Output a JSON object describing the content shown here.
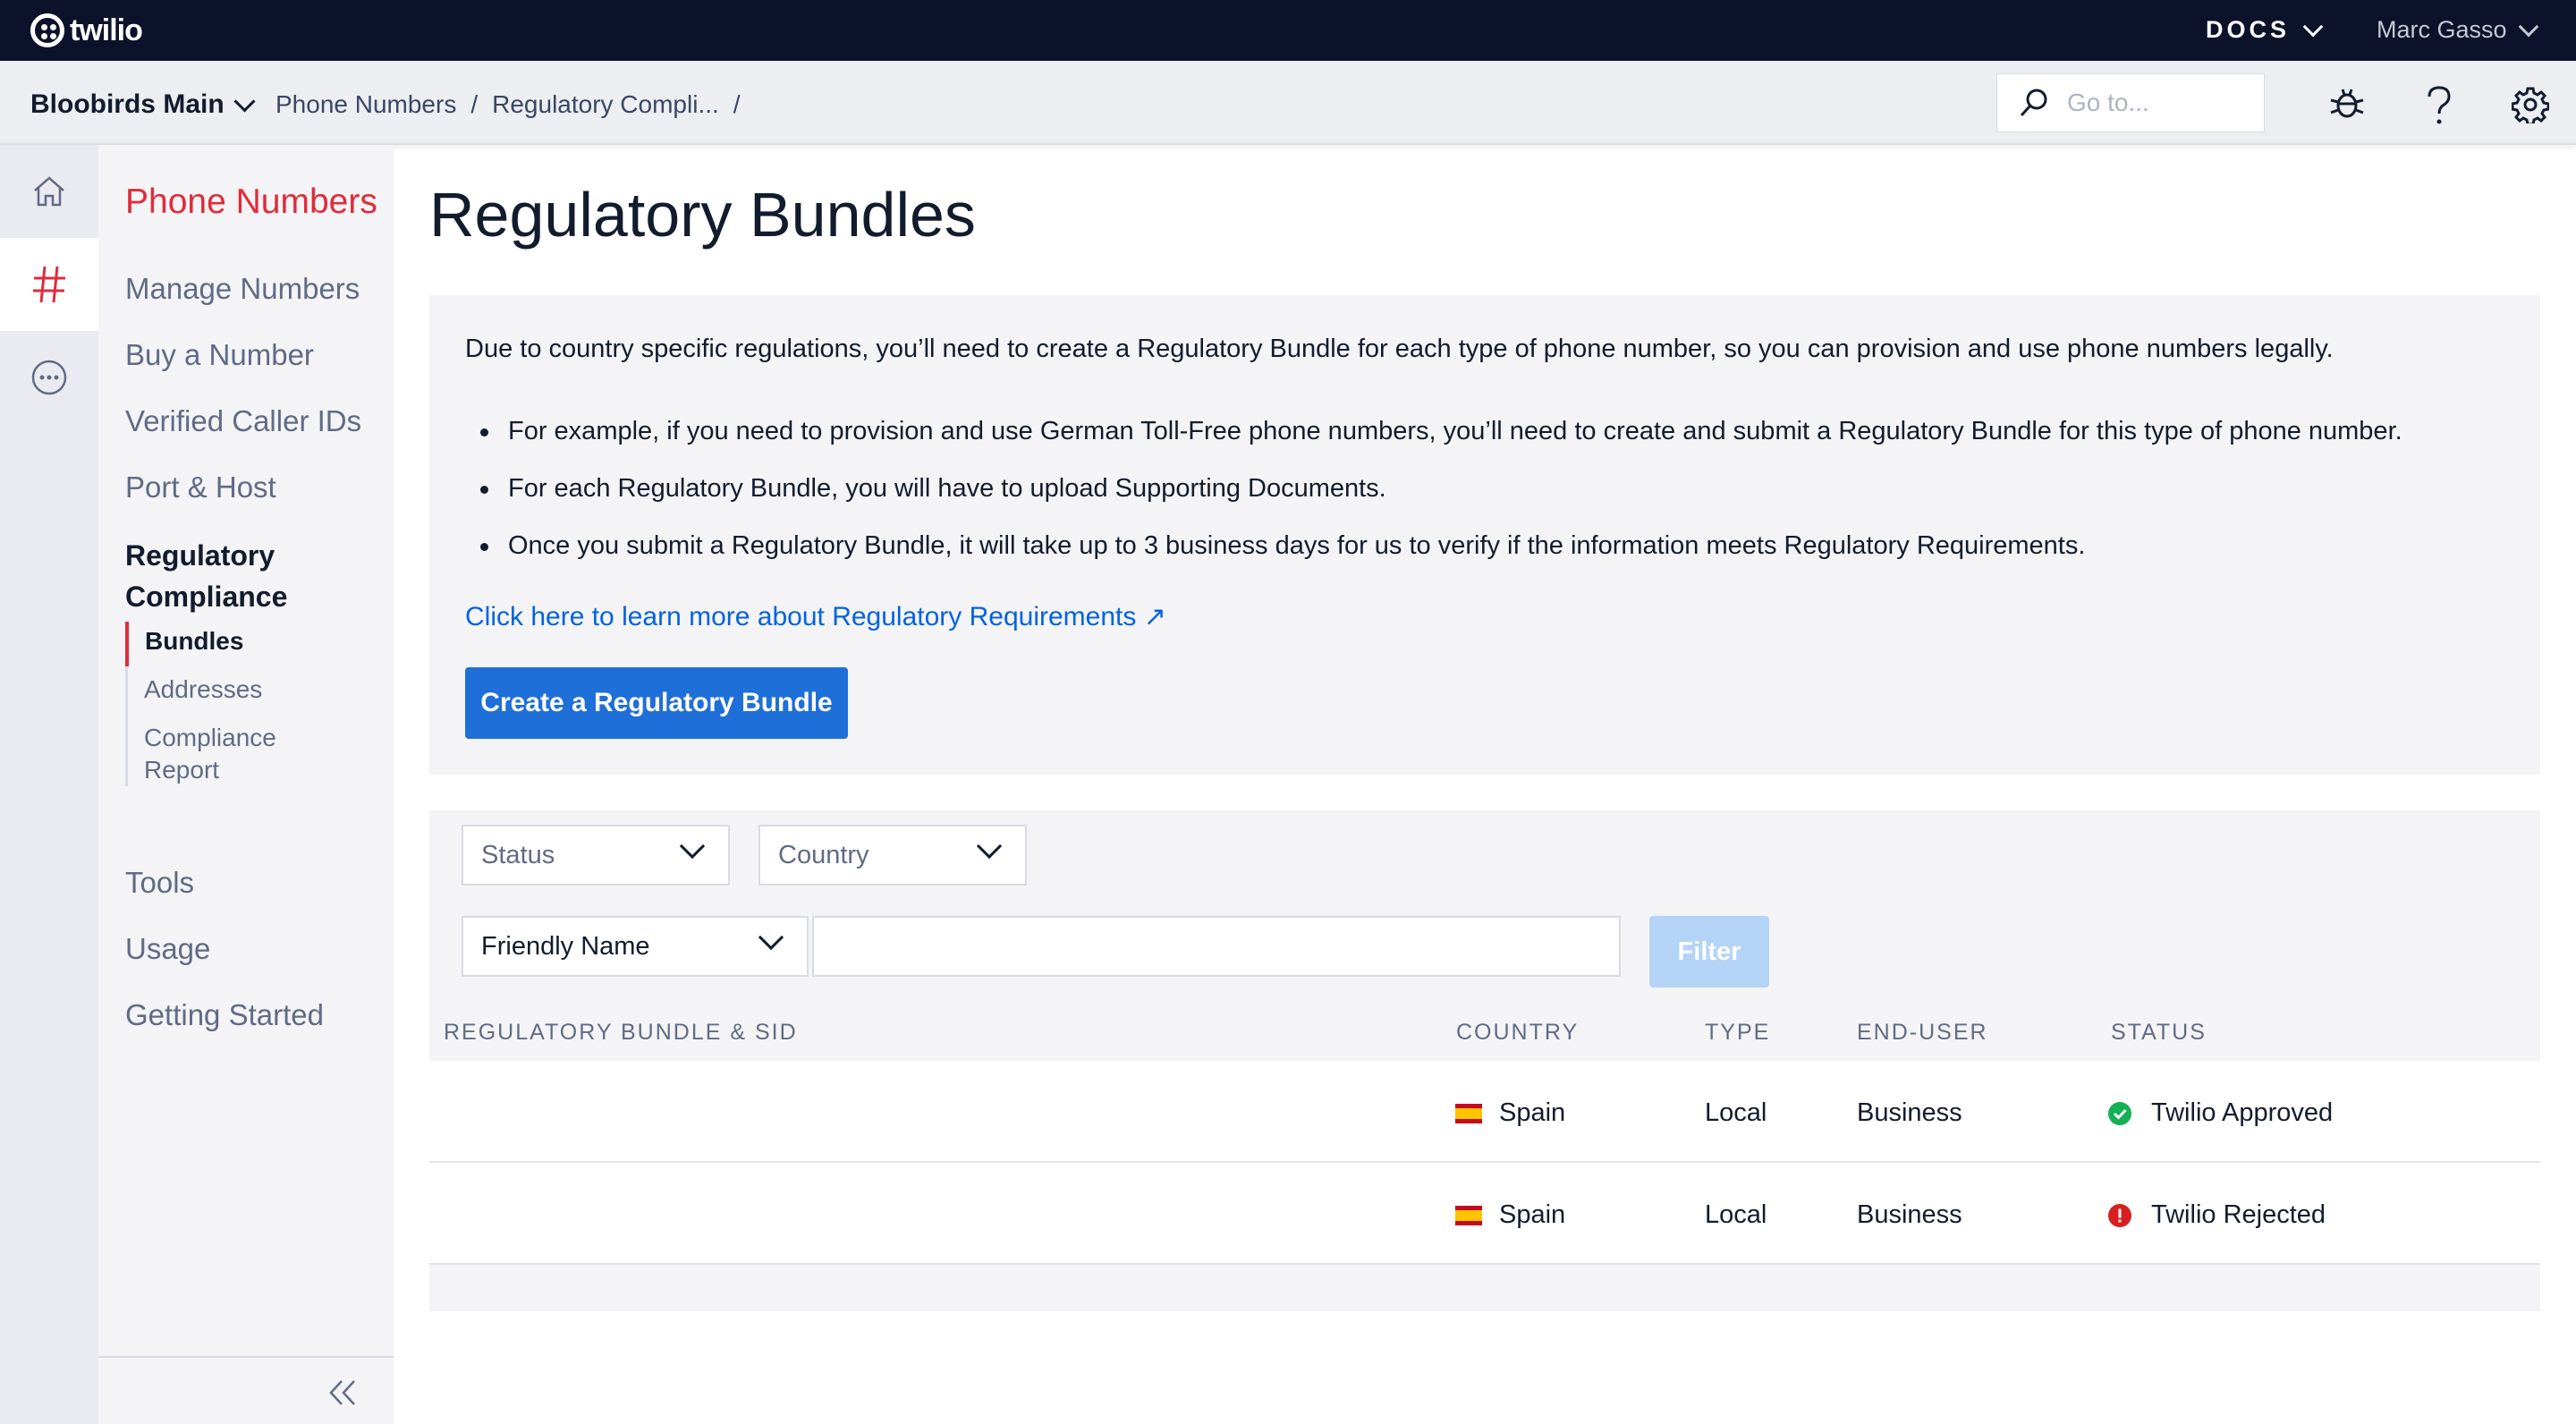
{
  "topbar": {
    "logo_text": "twilio",
    "docs_label": "DOCS",
    "user_name": "Marc Gasso",
    "bg_color": "#0d122b"
  },
  "subbar": {
    "account_name": "Bloobirds Main",
    "breadcrumbs": [
      "Phone Numbers",
      "/",
      "Regulatory Compli...",
      "/"
    ],
    "search_placeholder": "Go to...",
    "icons": [
      "bug-icon",
      "help-icon",
      "settings-gear-icon"
    ]
  },
  "rail": {
    "items": [
      "home-icon",
      "hash-icon",
      "more-icon"
    ],
    "active_index": 1
  },
  "sidebar": {
    "title": "Phone Numbers",
    "items": [
      "Manage Numbers",
      "Buy a Number",
      "Verified Caller IDs",
      "Port & Host"
    ],
    "section": "Regulatory Compliance",
    "section_lines": [
      "Regulatory",
      "Compliance"
    ],
    "sub_items": [
      "Bundles",
      "Addresses",
      "Compliance Report"
    ],
    "sub_item_lines": [
      "Compliance",
      "Report"
    ],
    "active_sub": "Bundles",
    "bottom_items": [
      "Tools",
      "Usage",
      "Getting Started"
    ],
    "accent_color": "#e12b3a"
  },
  "main": {
    "title": "Regulatory Bundles",
    "intro": "Due to country specific regulations, you’ll need to create a Regulatory Bundle for each type of phone number, so you can provision and use phone numbers legally.",
    "bullets": [
      "For example, if you need to provision and use German Toll-Free phone numbers, you’ll need to create and submit a Regulatory Bundle for this type of phone number.",
      "For each Regulatory Bundle, you will have to upload Supporting Documents.",
      "Once you submit a Regulatory Bundle, it will take up to 3 business days for us to verify if the information meets Regulatory Requirements."
    ],
    "learn_link": "Click here to learn more about Regulatory Requirements ↗",
    "create_button": "Create a Regulatory Bundle",
    "button_color": "#1f6fd8"
  },
  "filters": {
    "status_select": "Status",
    "country_select": "Country",
    "field_select": "Friendly Name",
    "text_value": "",
    "filter_button": "Filter"
  },
  "table": {
    "headers": [
      "REGULATORY BUNDLE & SID",
      "COUNTRY",
      "TYPE",
      "END-USER",
      "STATUS"
    ],
    "rows": [
      {
        "bundle": "",
        "country": "Spain",
        "type": "Local",
        "end_user": "Business",
        "status": "Twilio Approved",
        "status_icon": "check-circle-icon",
        "status_color": "#14b053"
      },
      {
        "bundle": "",
        "country": "Spain",
        "type": "Local",
        "end_user": "Business",
        "status": "Twilio Rejected",
        "status_icon": "error-circle-icon",
        "status_color": "#d61f1f"
      }
    ]
  }
}
